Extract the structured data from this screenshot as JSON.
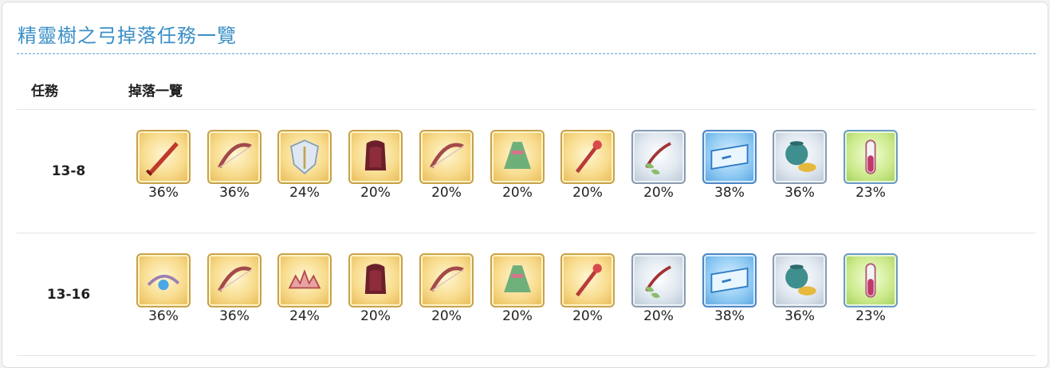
{
  "page": {
    "title": "精靈樹之弓掉落任務一覽"
  },
  "table": {
    "headers": {
      "quest": "任務",
      "drops": "掉落一覽"
    },
    "rows": [
      {
        "quest": "13-8",
        "drops": [
          {
            "icon": "red-sword-fragment-icon",
            "rate": "36%",
            "frame": "gold"
          },
          {
            "icon": "bow-fragment-icon",
            "rate": "36%",
            "frame": "gold"
          },
          {
            "icon": "shield-fragment-icon",
            "rate": "24%",
            "frame": "gold"
          },
          {
            "icon": "dark-cloak-fragment-icon",
            "rate": "20%",
            "frame": "gold"
          },
          {
            "icon": "bow-fragment-icon",
            "rate": "20%",
            "frame": "gold"
          },
          {
            "icon": "green-dress-fragment-icon",
            "rate": "20%",
            "frame": "gold"
          },
          {
            "icon": "red-staff-fragment-icon",
            "rate": "20%",
            "frame": "gold"
          },
          {
            "icon": "leaf-ribbon-fragment-icon",
            "rate": "20%",
            "frame": "silver"
          },
          {
            "icon": "blue-ticket-icon",
            "rate": "38%",
            "frame": "blue"
          },
          {
            "icon": "mana-pot-coins-icon",
            "rate": "36%",
            "frame": "silver"
          },
          {
            "icon": "potion-vial-icon",
            "rate": "23%",
            "frame": "green"
          }
        ]
      },
      {
        "quest": "13-16",
        "drops": [
          {
            "icon": "blue-gem-amulet-fragment-icon",
            "rate": "36%",
            "frame": "gold"
          },
          {
            "icon": "bow-fragment-icon",
            "rate": "36%",
            "frame": "gold"
          },
          {
            "icon": "tiara-fragment-icon",
            "rate": "24%",
            "frame": "gold"
          },
          {
            "icon": "dark-cloak-fragment-icon",
            "rate": "20%",
            "frame": "gold"
          },
          {
            "icon": "bow-fragment-icon",
            "rate": "20%",
            "frame": "gold"
          },
          {
            "icon": "green-dress-fragment-icon",
            "rate": "20%",
            "frame": "gold"
          },
          {
            "icon": "red-staff-fragment-icon",
            "rate": "20%",
            "frame": "gold"
          },
          {
            "icon": "leaf-ribbon-fragment-icon",
            "rate": "20%",
            "frame": "silver"
          },
          {
            "icon": "blue-ticket-icon",
            "rate": "38%",
            "frame": "blue"
          },
          {
            "icon": "mana-pot-coins-icon",
            "rate": "36%",
            "frame": "silver"
          },
          {
            "icon": "potion-vial-icon",
            "rate": "23%",
            "frame": "green"
          }
        ]
      }
    ]
  },
  "colors": {
    "title": "#3a8fc7",
    "gold_frame": "#c8a24a",
    "silver_frame": "#8a9bb0",
    "blue_frame": "#4f86c4"
  }
}
